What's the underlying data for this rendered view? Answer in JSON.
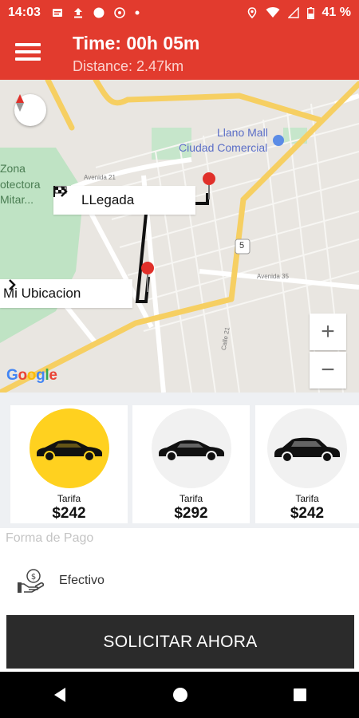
{
  "status_bar": {
    "time": "14:03",
    "battery": "41 %"
  },
  "header": {
    "trip_time": "Time: 00h 05m",
    "distance": "Distance: 2.47km"
  },
  "map": {
    "labels": {
      "mall_line1": "Llano Mall",
      "mall_line2": "Ciudad Comercial",
      "zona_line1": "Zona",
      "zona_line2": "otectora",
      "zona_line3": "Mitar...",
      "avenida_21": "Avenida 21",
      "avenida_35": "Avenida 35",
      "calle_21": "Calle 21",
      "route_5": "5"
    },
    "destination_label": "LLegada",
    "origin_label": "Mi Ubicacion",
    "zoom_in": "+",
    "zoom_out": "−",
    "google": "Google"
  },
  "cars": [
    {
      "tarifa_label": "Tarifa",
      "price": "$242",
      "selected": true
    },
    {
      "tarifa_label": "Tarifa",
      "price": "$292",
      "selected": false
    },
    {
      "tarifa_label": "Tarifa",
      "price": "$242",
      "selected": false
    }
  ],
  "payment": {
    "section_label": "Forma de Pago",
    "method": "Efectivo"
  },
  "action": {
    "request_label": "SOLICITAR AHORA"
  },
  "colors": {
    "brand_red": "#e23b2e",
    "selected_yellow": "#ffd11f",
    "button_dark": "#2b2b2b"
  },
  "icons": [
    "menu-icon",
    "compass-icon",
    "flag-icon",
    "chevron-right-icon",
    "map-pin-icon",
    "car-icon",
    "cash-hand-icon",
    "back-icon",
    "home-icon",
    "recents-icon"
  ]
}
